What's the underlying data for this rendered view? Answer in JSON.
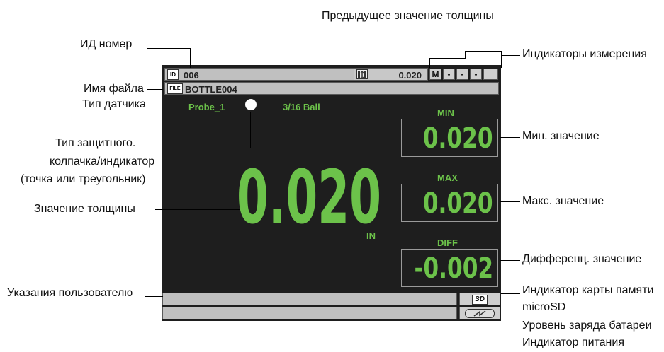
{
  "callouts": {
    "prev_thickness": "Предыдущее значение толщины",
    "id_number": "ИД номер",
    "meas_indicators": "Индикаторы измерения",
    "file_name": "Имя файла",
    "probe_type": "Тип датчика",
    "cap_type_1": "Тип защитного.",
    "cap_type_2": "колпачка/индикатор",
    "cap_type_3": "(точка или треугольник)",
    "thickness_value": "Значение толщины",
    "min_value": "Мин. значение",
    "max_value": "Макс. значение",
    "diff_value": "Дифференц. значение",
    "user_hints": "Указания пользователю",
    "sd_card_1": "Индикатор карты памяти",
    "sd_card_2": "microSD",
    "battery": "Уровень заряда батареи",
    "power": "Индикатор питания"
  },
  "screen": {
    "id_icon": "ID",
    "id_value": "006",
    "prev_icon": "thickness-gauge-icon",
    "prev_value": "0.020",
    "mode": "M",
    "indicators": [
      "-",
      "-",
      "-",
      ""
    ],
    "file_icon": "FILE",
    "file_value": "BOTTLE004",
    "probe": "Probe_1",
    "tip": "3/16 Ball",
    "thickness": "0.020",
    "unit": "IN",
    "min_label": "MIN",
    "min_value": "0.020",
    "max_label": "MAX",
    "max_value": "0.020",
    "diff_label": "DIFF",
    "diff_value": "-0.002",
    "sd_icon": "SD"
  },
  "colors": {
    "reading_green": "#6cc24a",
    "screen_bg": "#1e1e1e",
    "bar_gray": "#c0c0c0"
  }
}
